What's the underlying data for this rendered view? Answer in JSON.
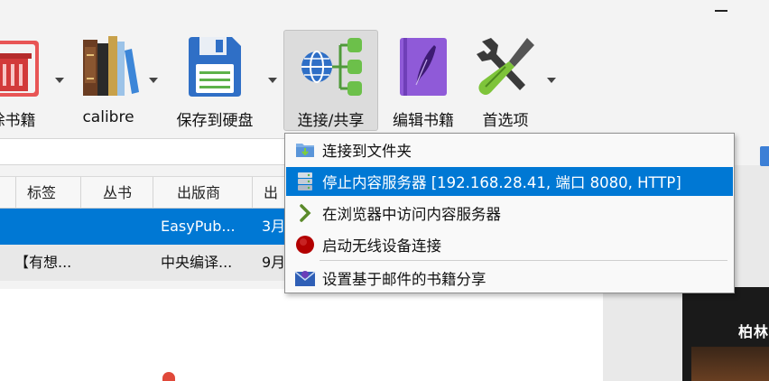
{
  "toolbar": {
    "remove_books_label": "除书籍",
    "calibre_label": "calibre",
    "save_label": "保存到硬盘",
    "connect_share_label": "连接/共享",
    "edit_book_label": "编辑书籍",
    "preferences_label": "首选项"
  },
  "table": {
    "headers": [
      "标签",
      "丛书",
      "出版商",
      "出"
    ],
    "rows": [
      {
        "tags": "",
        "series": "",
        "publisher": "EasyPub...",
        "date": "3月"
      },
      {
        "tags": "【有想...",
        "series": "",
        "publisher": "中央编译...",
        "date": "9月"
      }
    ]
  },
  "menu": {
    "items": [
      {
        "label": "连接到文件夹",
        "icon": "folder-icon"
      },
      {
        "label": "停止内容服务器 [192.168.28.41, 端口 8080, HTTP]",
        "icon": "server-icon"
      },
      {
        "label": "在浏览器中访问内容服务器",
        "icon": "chevron-right-icon"
      },
      {
        "label": "启动无线设备连接",
        "icon": "red-circle-icon"
      },
      {
        "label": "设置基于邮件的书籍分享",
        "icon": "mail-icon"
      }
    ]
  },
  "cover": {
    "text": "柏林"
  },
  "colors": {
    "accent": "#0078d4",
    "menu_bg": "#f9f9f9"
  }
}
